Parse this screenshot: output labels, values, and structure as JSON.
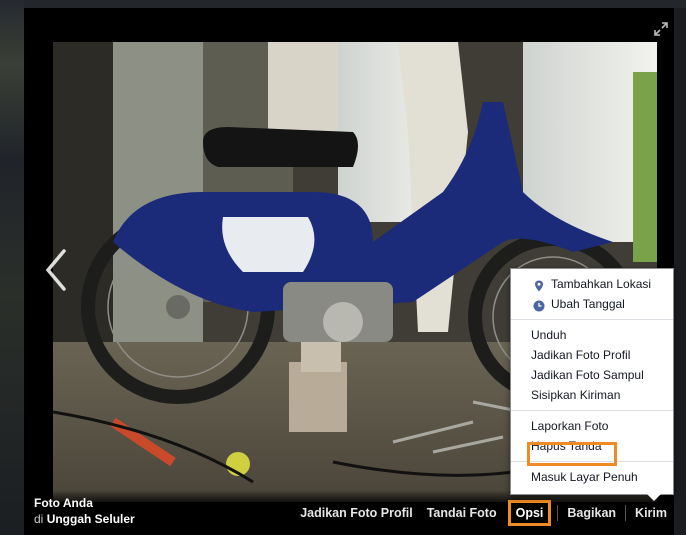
{
  "owner": {
    "title": "Foto Anda",
    "prefix": "di",
    "album": "Unggah Seluler"
  },
  "actions": [
    {
      "label": "Jadikan Foto Profil"
    },
    {
      "label": "Tandai Foto"
    },
    {
      "label": "Opsi"
    },
    {
      "label": "Bagikan"
    },
    {
      "label": "Kirim"
    }
  ],
  "menu": {
    "location": "Tambahkan Lokasi",
    "date": "Ubah Tanggal",
    "download": "Unduh",
    "profile_photo": "Jadikan Foto Profil",
    "cover_photo": "Jadikan Foto Sampul",
    "embed_post": "Sisipkan Kiriman",
    "report": "Laporkan Foto",
    "remove_tag": "Hapus Tanda",
    "fullscreen": "Masuk Layar Penuh"
  },
  "icons": {
    "location": "map-pin-icon",
    "date": "clock-icon",
    "expand": "expand-icon",
    "prev": "chevron-left-icon"
  },
  "colors": {
    "highlight": "#f08a24",
    "icon_blue": "#4b67a1",
    "menu_text": "#141823"
  }
}
